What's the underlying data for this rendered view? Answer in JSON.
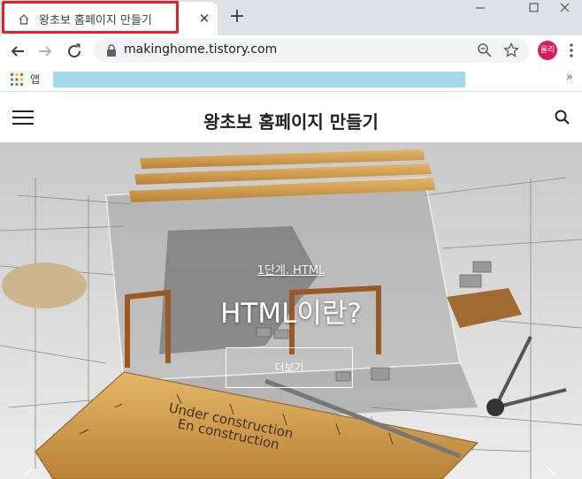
{
  "browser": {
    "tab_title": "왕초보 홈페이지 만들기",
    "tab_close": "✕",
    "new_tab": "+",
    "url": "makinghome.tistory.com",
    "profile_label": "올리",
    "bookmarks_apps_label": "앱",
    "bookmarks_more": "»",
    "highlight_color": "#e0202a"
  },
  "site": {
    "title": "왕초보 홈페이지 만들기"
  },
  "hero": {
    "category": "1단계. HTML",
    "title": "HTML이란?",
    "more_button": "더보기"
  }
}
